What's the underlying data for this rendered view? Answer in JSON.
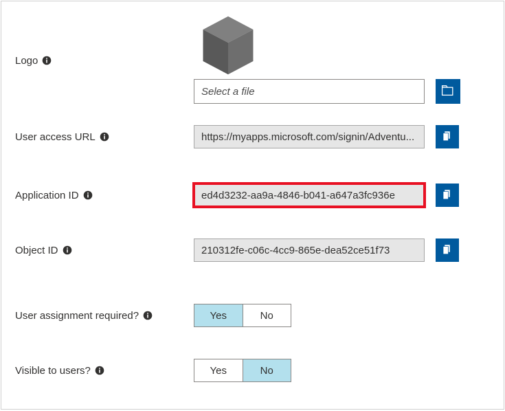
{
  "labels": {
    "logo": "Logo",
    "user_access_url": "User access URL",
    "application_id": "Application ID",
    "object_id": "Object ID",
    "user_assignment_required": "User assignment required?",
    "visible_to_users": "Visible to users?"
  },
  "file_select": {
    "placeholder": "Select a file"
  },
  "values": {
    "user_access_url": "https://myapps.microsoft.com/signin/Adventu...",
    "application_id": "ed4d3232-aa9a-4846-b041-a647a3fc936e",
    "object_id": "210312fe-c06c-4cc9-865e-dea52ce51f73"
  },
  "toggles": {
    "yes": "Yes",
    "no": "No",
    "user_assignment_required_selected": "Yes",
    "visible_to_users_selected": "No"
  },
  "icons": {
    "info": "info-icon",
    "browse": "folder-open-icon",
    "copy": "copy-icon",
    "cube": "cube-icon"
  },
  "colors": {
    "accent": "#005a9e",
    "highlight": "#e81123",
    "toggle_selected": "#b3e0ed",
    "readonly_bg": "#e6e6e6"
  }
}
